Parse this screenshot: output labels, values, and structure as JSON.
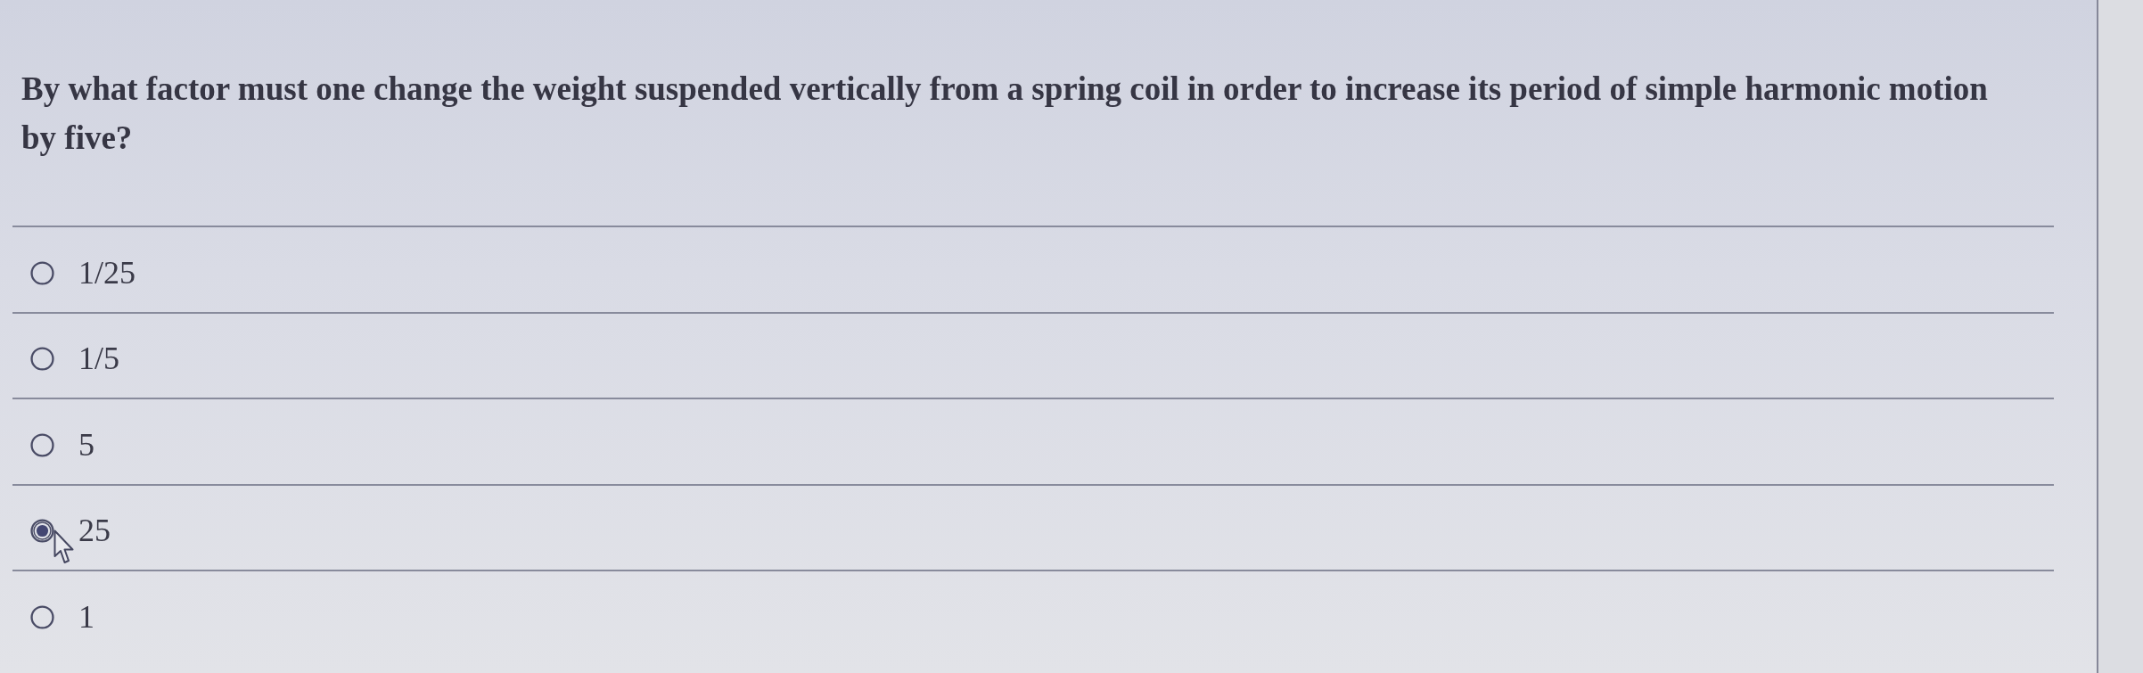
{
  "question": {
    "text": "By what factor must one change the weight suspended vertically from a spring coil in order to increase its period of simple harmonic motion by five?"
  },
  "options": [
    {
      "label": "1/25",
      "selected": false
    },
    {
      "label": "1/5",
      "selected": false
    },
    {
      "label": "5",
      "selected": false
    },
    {
      "label": "25",
      "selected": true
    },
    {
      "label": "1",
      "selected": false
    }
  ]
}
